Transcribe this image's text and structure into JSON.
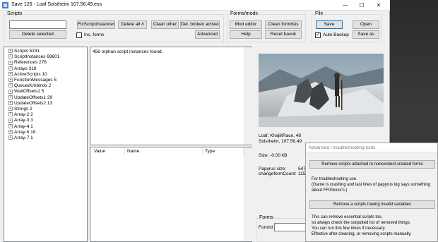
{
  "title": "Save 126 - Loaf  Solstheim  107.56.49.ess",
  "window_controls": {
    "minimize": "—",
    "maximize": "☐",
    "close": "✕"
  },
  "scripts_group": {
    "label": "Scripts",
    "delete_selected": "Delete selected",
    "fix_script_instances": "FixScriptInstances",
    "delete_all": "Delete all #",
    "inc_forms": "Inc. forms",
    "clean_other": "Clean other",
    "del_broken_actives": "Del. broken actives",
    "advanced": "Advanced"
  },
  "forms_mods": {
    "label": "Forms/mods",
    "mod_editor": "Mod editor",
    "clean_formlists": "Clean formlists",
    "help": "Help",
    "reset_havok": "Reset havok"
  },
  "file_group": {
    "label": "File",
    "save": "Save",
    "open": "Open",
    "auto_backup": "Auto Backup",
    "auto_backup_checked": true,
    "save_as": "Save as"
  },
  "tree": [
    "Scripts 5231",
    "ScriptInstances 69601",
    "References 276",
    "Arrays 319",
    "ActiveScripts 10",
    "FunctionMessages 5",
    "QueuedUnbinds 2",
    "WaitOffsets1 5",
    "UpdateOffsets1 29",
    "UpdateOffsets2 13",
    "Strings 2",
    "Array-2 2",
    "Array-3 3",
    "Array-4 1",
    "Array-5 18",
    "Array-7 1"
  ],
  "info_text": "456 orphan script instances found.",
  "table_columns": [
    "Value",
    "Name",
    "Type"
  ],
  "save_info": {
    "line1": "Loaf, KhajiitRace, 48",
    "line2": "Solstheim, 107.56.49",
    "size": "Size: -0.00 kB",
    "papyrus_size_label": "Papyrus size:",
    "papyrus_size_value": "547",
    "change_form_label": "changeformCount:",
    "change_form_value": "115"
  },
  "forms_bottom": {
    "label": "Forms",
    "formid_label": "FormId"
  },
  "advanced_dialog": {
    "title": "Advanced / troubleshooting tools",
    "btn_remove_attached": "Remove scripts attached to nonexistent created forms",
    "troubleshoot_text": "For troubleshooting use.\n(Game is crashing and last lines of papyrus log says something about FF00xxxx's.)",
    "btn_remove_invalid": "Remove a scripts having invalid variables",
    "warn_text": "This can remove essential scripts too,\nso always check the outputted list of removed things.\nYou can run this few times if necessary.\nEffective after cleaning, or removing scripts manually."
  }
}
